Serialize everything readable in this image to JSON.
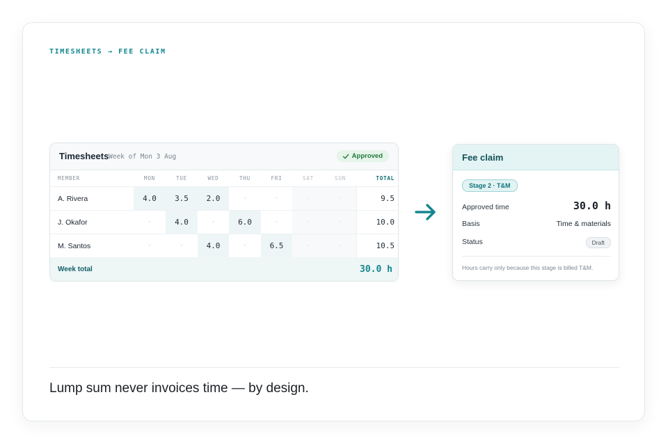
{
  "eyebrow": "TIMESHEETS → FEE CLAIM",
  "timesheet": {
    "title": "Timesheets",
    "week": "Week of Mon 3 Aug",
    "status": "Approved",
    "columns": {
      "member": "MEMBER",
      "mon": "MON",
      "tue": "TUE",
      "wed": "WED",
      "thu": "THU",
      "fri": "FRI",
      "sat": "SAT",
      "sun": "SUN",
      "total": "TOTAL"
    },
    "empty_mark": "·",
    "rows": [
      {
        "name": "A. Rivera",
        "mon": "4.0",
        "tue": "3.5",
        "wed": "2.0",
        "thu": "·",
        "fri": "·",
        "sat": "·",
        "sun": "·",
        "total": "9.5"
      },
      {
        "name": "J. Okafor",
        "mon": "·",
        "tue": "4.0",
        "wed": "·",
        "thu": "6.0",
        "fri": "·",
        "sat": "·",
        "sun": "·",
        "total": "10.0"
      },
      {
        "name": "M. Santos",
        "mon": "·",
        "tue": "·",
        "wed": "4.0",
        "thu": "·",
        "fri": "6.5",
        "sat": "·",
        "sun": "·",
        "total": "10.5"
      }
    ],
    "footer_label": "Week total",
    "footer_total": "30.0 h"
  },
  "fee_claim": {
    "title": "Fee claim",
    "stage": "Stage 2 · T&M",
    "approved_label": "Approved time",
    "approved_value": "30.0 h",
    "basis_label": "Basis",
    "basis_value": "Time & materials",
    "status_label": "Status",
    "status_value": "Draft",
    "note": "Hours carry only because this stage is billed T&M."
  },
  "tagline": "Lump sum never invoices time — by design.",
  "colors": {
    "accent": "#13878f",
    "approved_bg": "#e6f4ea",
    "approved_text": "#247a3e"
  },
  "icons": {
    "check": "check-icon",
    "arrow": "arrow-right-icon"
  }
}
